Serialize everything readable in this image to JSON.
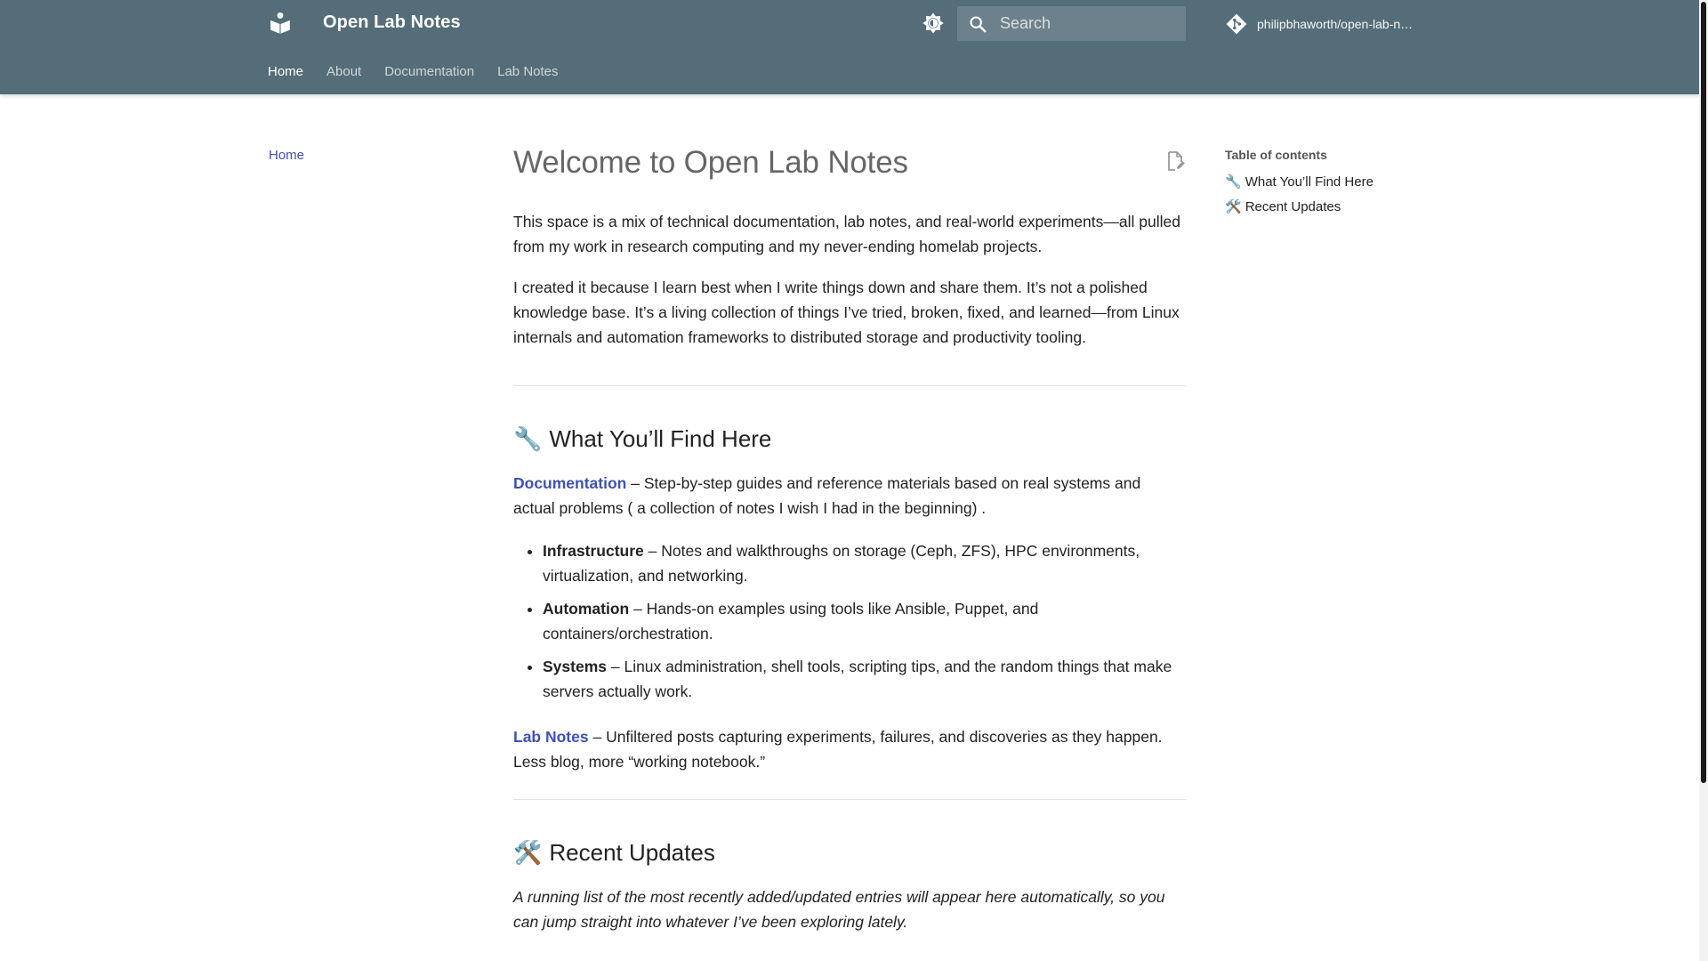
{
  "header": {
    "site_title": "Open Lab Notes",
    "search_placeholder": "Search",
    "repo_name": "philipbhaworth/open-lab-n…",
    "tabs": [
      {
        "label": "Home",
        "active": true
      },
      {
        "label": "About"
      },
      {
        "label": "Documentation"
      },
      {
        "label": "Lab Notes"
      }
    ]
  },
  "nav": {
    "items": [
      {
        "label": "Home"
      }
    ]
  },
  "content": {
    "title": "Welcome to Open Lab Notes",
    "intro_1": "This space is a mix of technical documentation, lab notes, and real-world experiments—all pulled from my work in research computing and my never-ending homelab projects.",
    "intro_2": "I created it because I learn best when I write things down and share them. It’s not a polished knowledge base. It’s a living collection of things I’ve tried, broken, fixed, and learned—from Linux internals and automation frameworks to distributed storage and productivity tooling.",
    "section_1": {
      "emoji": "🔧",
      "heading": "What You’ll Find Here",
      "doc_link": "Documentation",
      "doc_text": " – Step-by-step guides and reference materials based on real systems and actual problems ( a collection of notes I wish I had in the beginning) .",
      "bullets": [
        {
          "term": "Infrastructure",
          "text": " – Notes and walkthroughs on storage (Ceph, ZFS), HPC environments, virtualization, and networking."
        },
        {
          "term": "Automation",
          "text": " – Hands-on examples using tools like Ansible, Puppet, and containers/orchestration."
        },
        {
          "term": "Systems",
          "text": " – Linux administration, shell tools, scripting tips, and the random things that make servers actually work."
        }
      ],
      "lab_link": "Lab Notes",
      "lab_text": " – Unfiltered posts capturing experiments, failures, and discoveries as they happen. Less blog, more “working notebook.”"
    },
    "section_2": {
      "emoji": "🛠️",
      "heading": "Recent Updates",
      "text": "A running list of the most recently added/updated entries will appear here automatically, so you can jump straight into whatever I’ve been exploring lately."
    }
  },
  "toc": {
    "title": "Table of contents",
    "items": [
      {
        "emoji": "🔧",
        "label": "What You’ll Find Here"
      },
      {
        "emoji": "🛠️",
        "label": "Recent Updates"
      }
    ]
  },
  "colors": {
    "header_bg": "#546d78",
    "link": "#3f51b5"
  }
}
